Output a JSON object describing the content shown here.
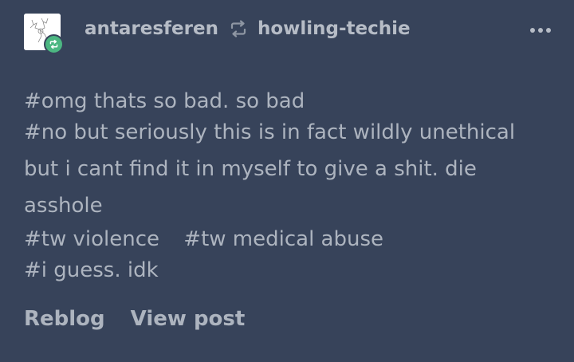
{
  "post": {
    "author": "antaresferen",
    "reblogged_from": "howling-techie",
    "tags": [
      "#omg thats so bad. so bad",
      "#no but seriously this is in fact wildly unethical but i cant find it in myself to give a shit. die asshole",
      "#tw violence",
      "#tw medical abuse",
      "#i guess. idk"
    ],
    "actions": {
      "reblog": "Reblog",
      "view_post": "View post"
    }
  },
  "icons": {
    "reblog_badge": "reblog-icon",
    "menu": "more-options-icon"
  },
  "colors": {
    "background": "#37435a",
    "text": "#b3b9c3",
    "reblog_badge": "#4cb782"
  }
}
